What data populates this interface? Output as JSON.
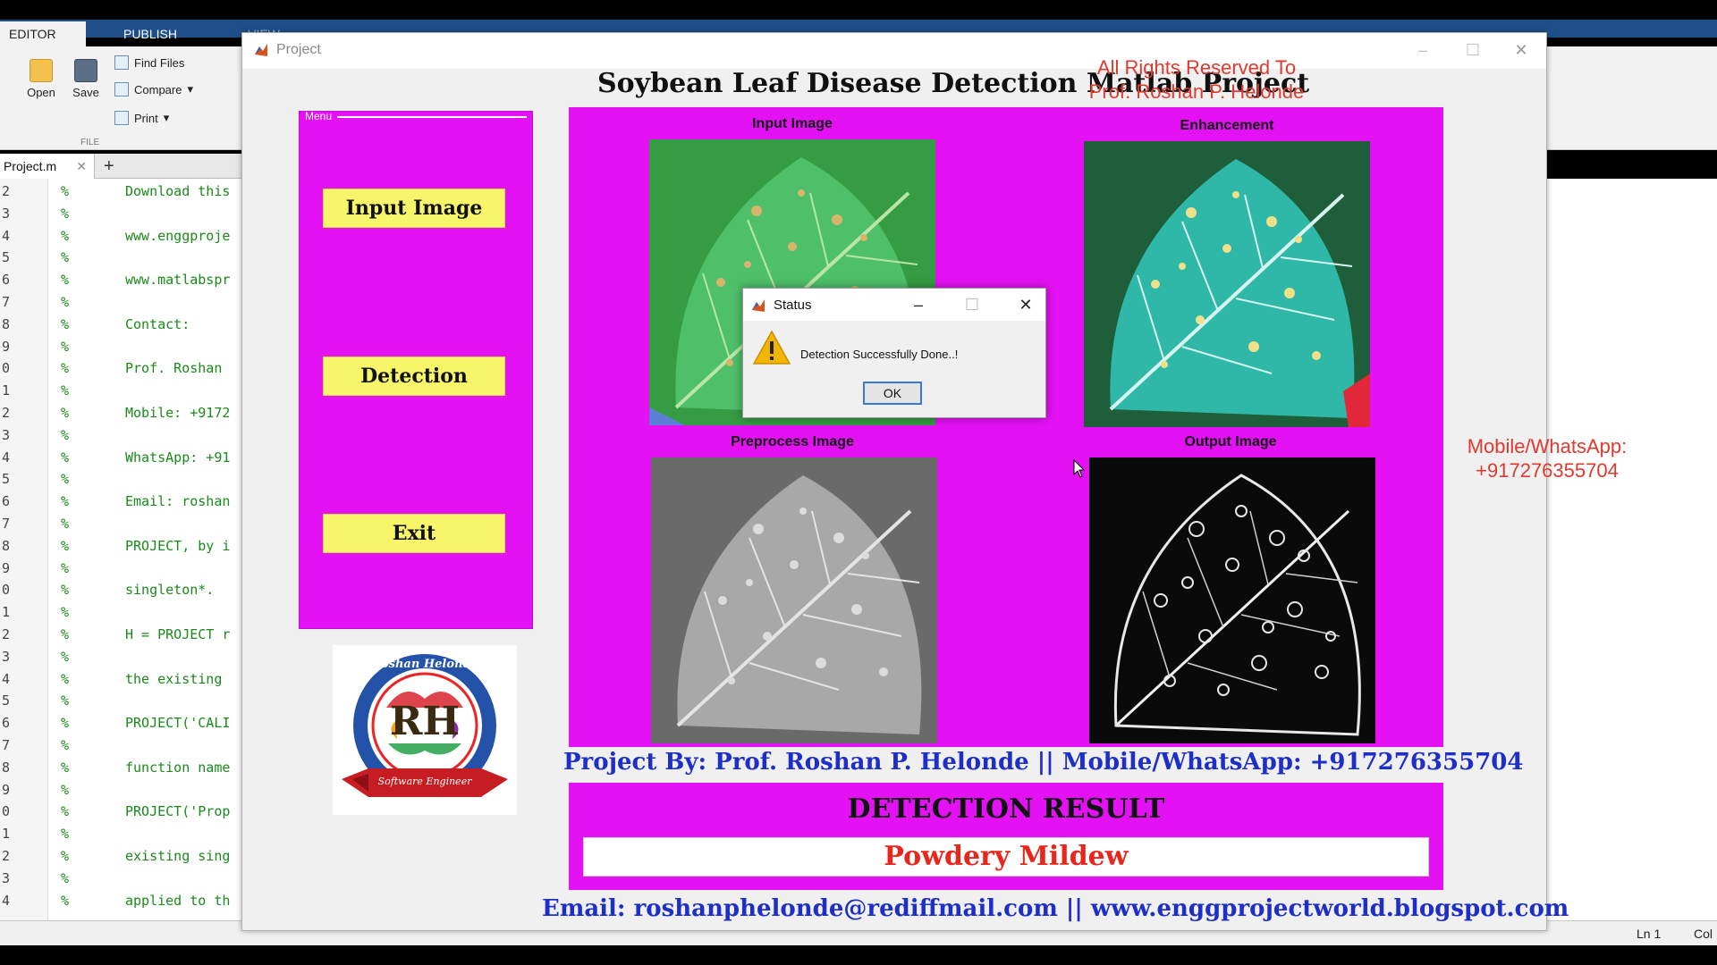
{
  "matlab": {
    "tabs": [
      "EDITOR",
      "PUBLISH",
      "VIEW"
    ],
    "ribbon": {
      "open_label": "Open",
      "save_label": "Save",
      "find_files_label": "Find Files",
      "compare_label": "Compare",
      "print_label": "Print",
      "group_label": "FILE"
    },
    "file_tab": "Project.m",
    "code_lines": [
      {
        "num": "2",
        "text": "Download this"
      },
      {
        "num": "3",
        "text": ""
      },
      {
        "num": "4",
        "text": "www.enggproje"
      },
      {
        "num": "5",
        "text": ""
      },
      {
        "num": "6",
        "text": "www.matlabspr"
      },
      {
        "num": "7",
        "text": ""
      },
      {
        "num": "8",
        "text": "Contact:"
      },
      {
        "num": "9",
        "text": ""
      },
      {
        "num": "0",
        "text": "Prof. Roshan"
      },
      {
        "num": "1",
        "text": ""
      },
      {
        "num": "2",
        "text": "Mobile: +9172"
      },
      {
        "num": "3",
        "text": ""
      },
      {
        "num": "4",
        "text": "WhatsApp: +91"
      },
      {
        "num": "5",
        "text": ""
      },
      {
        "num": "6",
        "text": "Email: roshan"
      },
      {
        "num": "7",
        "text": ""
      },
      {
        "num": "8",
        "text": "PROJECT, by i"
      },
      {
        "num": "9",
        "text": ""
      },
      {
        "num": "0",
        "text": "singleton*."
      },
      {
        "num": "1",
        "text": ""
      },
      {
        "num": "2",
        "text": "H = PROJECT r"
      },
      {
        "num": "3",
        "text": ""
      },
      {
        "num": "4",
        "text": "the existing"
      },
      {
        "num": "5",
        "text": ""
      },
      {
        "num": "6",
        "text": "PROJECT('CALI"
      },
      {
        "num": "7",
        "text": ""
      },
      {
        "num": "8",
        "text": "function name"
      },
      {
        "num": "9",
        "text": ""
      },
      {
        "num": "0",
        "text": "PROJECT('Prop"
      },
      {
        "num": "1",
        "text": ""
      },
      {
        "num": "2",
        "text": "existing sing"
      },
      {
        "num": "3",
        "text": ""
      },
      {
        "num": "4",
        "text": "applied to th"
      }
    ],
    "status_ln": "Ln  1",
    "status_col": "Col"
  },
  "project_window": {
    "title": "Project",
    "main_title": "Soybean Leaf Disease Detection Matlab Project",
    "rights_line1": "All Rights Reserved To",
    "rights_line2": "Prof. Roshan P. Helonde",
    "menu": {
      "label": "Menu",
      "input_image": "Input Image",
      "detection": "Detection",
      "exit": "Exit"
    },
    "logo": {
      "top_text": "Roshan Helonde",
      "letters": "RH",
      "ribbon_text": "Software Engineer"
    },
    "images": {
      "input": "Input Image",
      "enhancement": "Enhancement",
      "preprocess": "Preprocess Image",
      "output": "Output Image"
    },
    "credits": "Project By: Prof. Roshan P. Helonde ||   Mobile/WhatsApp: +917276355704",
    "result_heading": "DETECTION RESULT",
    "result_value": "Powdery Mildew",
    "email_line": "Email: roshanphelonde@rediffmail.com ||   www.enggprojectworld.blogspot.com",
    "mobile_line1": "Mobile/WhatsApp:",
    "mobile_line2": "+917276355704"
  },
  "status_dialog": {
    "title": "Status",
    "message": "Detection Successfully Done..!",
    "ok_label": "OK"
  },
  "colors": {
    "panel_magenta": "#e411f4",
    "button_yellow": "#f7f56a",
    "credit_blue": "#1e2ec8",
    "rights_red": "#e03a2e",
    "result_red": "#e8261c"
  }
}
